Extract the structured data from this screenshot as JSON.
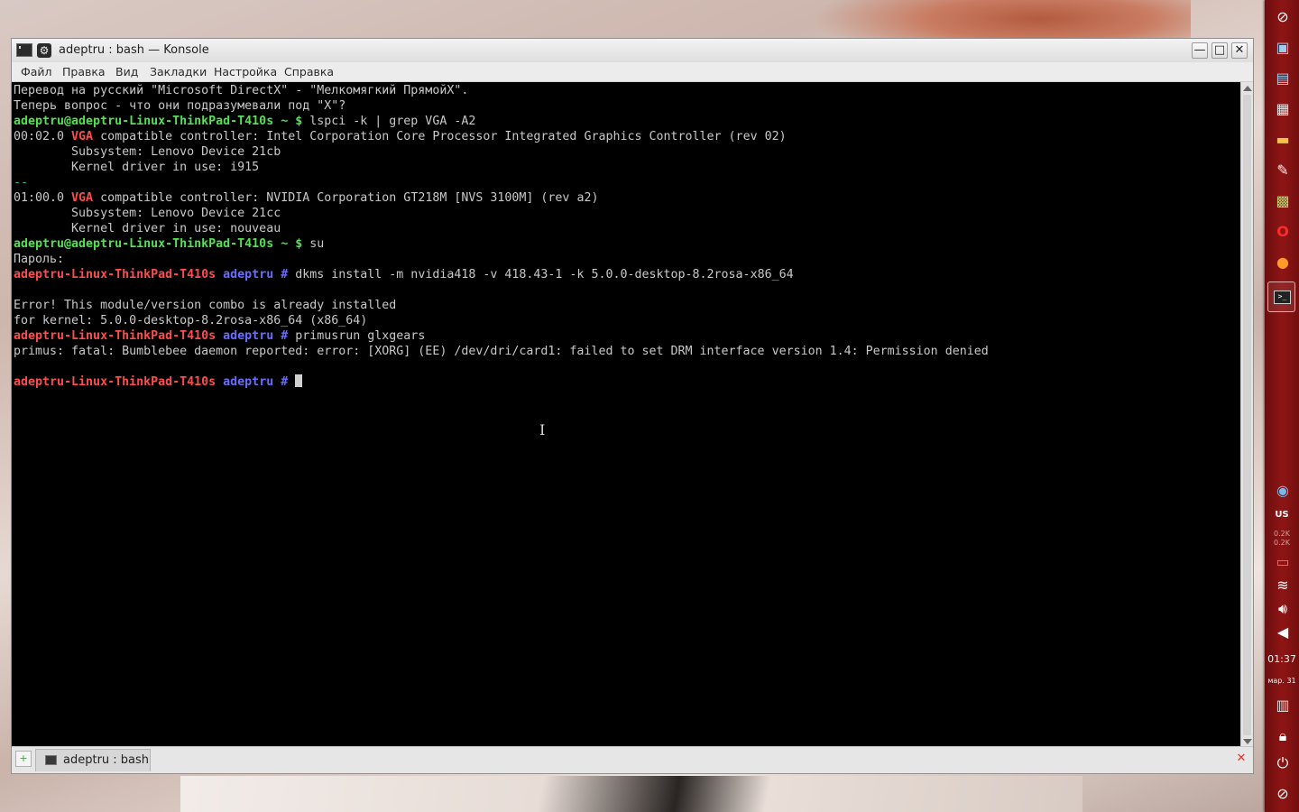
{
  "window": {
    "title": "adeptru : bash — Konsole",
    "buttons": {
      "minimize": "—",
      "maximize": "□",
      "close": "✕"
    }
  },
  "menu": [
    "Файл",
    "Правка",
    "Вид",
    "Закладки",
    "Настройка",
    "Справка"
  ],
  "terminal": {
    "lines": [
      [
        {
          "t": "Перевод на русский \"Microsoft DirectX\" - \"Мелкомягкий ПрямойХ\".",
          "c": "dim"
        }
      ],
      [
        {
          "t": "Теперь вопрос - что они подразумевали под \"X\"?",
          "c": "dim"
        }
      ],
      [
        {
          "t": "adeptru@adeptru-Linux-ThinkPad-T410s ~ $",
          "c": "green"
        },
        {
          "t": " lspci -k | grep VGA -A2",
          "c": "dim"
        }
      ],
      [
        {
          "t": "00:02.0 ",
          "c": "dim"
        },
        {
          "t": "VGA",
          "c": "vga"
        },
        {
          "t": " compatible controller: Intel Corporation Core Processor Integrated Graphics Controller (rev 02)",
          "c": "dim"
        }
      ],
      [
        {
          "t": "        Subsystem: Lenovo Device 21cb",
          "c": "dim"
        }
      ],
      [
        {
          "t": "        Kernel driver in use: i915",
          "c": "dim"
        }
      ],
      [
        {
          "t": "--",
          "c": "sep"
        }
      ],
      [
        {
          "t": "01:00.0 ",
          "c": "dim"
        },
        {
          "t": "VGA",
          "c": "vga"
        },
        {
          "t": " compatible controller: NVIDIA Corporation GT218M [NVS 3100M] (rev a2)",
          "c": "dim"
        }
      ],
      [
        {
          "t": "        Subsystem: Lenovo Device 21cc",
          "c": "dim"
        }
      ],
      [
        {
          "t": "        Kernel driver in use: nouveau",
          "c": "dim"
        }
      ],
      [
        {
          "t": "adeptru@adeptru-Linux-ThinkPad-T410s ~ $",
          "c": "green"
        },
        {
          "t": " su",
          "c": "dim"
        }
      ],
      [
        {
          "t": "Пароль:",
          "c": "dim"
        }
      ],
      [
        {
          "t": "adeptru-Linux-ThinkPad-T410s",
          "c": "red"
        },
        {
          "t": " adeptru #",
          "c": "blue"
        },
        {
          "t": " dkms install -m nvidia418 -v 418.43-1 -k 5.0.0-desktop-8.2rosa-x86_64",
          "c": "dim"
        }
      ],
      [
        {
          "t": "",
          "c": "dim"
        }
      ],
      [
        {
          "t": "Error! This module/version combo is already installed",
          "c": "dim"
        }
      ],
      [
        {
          "t": "for kernel: 5.0.0-desktop-8.2rosa-x86_64 (x86_64)",
          "c": "dim"
        }
      ],
      [
        {
          "t": "adeptru-Linux-ThinkPad-T410s",
          "c": "red"
        },
        {
          "t": " adeptru #",
          "c": "blue"
        },
        {
          "t": " primusrun glxgears",
          "c": "dim"
        }
      ],
      [
        {
          "t": "primus: fatal: Bumblebee daemon reported: error: [XORG] (EE) /dev/dri/card1: failed to set DRM interface version 1.4: Permission denied",
          "c": "dim"
        }
      ],
      [
        {
          "t": "",
          "c": "dim"
        }
      ],
      [
        {
          "t": "adeptru-Linux-ThinkPad-T410s",
          "c": "red"
        },
        {
          "t": " adeptru #",
          "c": "blue"
        },
        {
          "t": " ",
          "c": "dim"
        },
        {
          "t": "",
          "c": "cursor"
        }
      ]
    ]
  },
  "tabs": [
    {
      "label": "adeptru : bash"
    }
  ],
  "panel": {
    "clock": "01:37",
    "date": "мар. 31",
    "net_up": "0.2K",
    "net_down": "0.2K",
    "keyboard_layout": "US"
  }
}
